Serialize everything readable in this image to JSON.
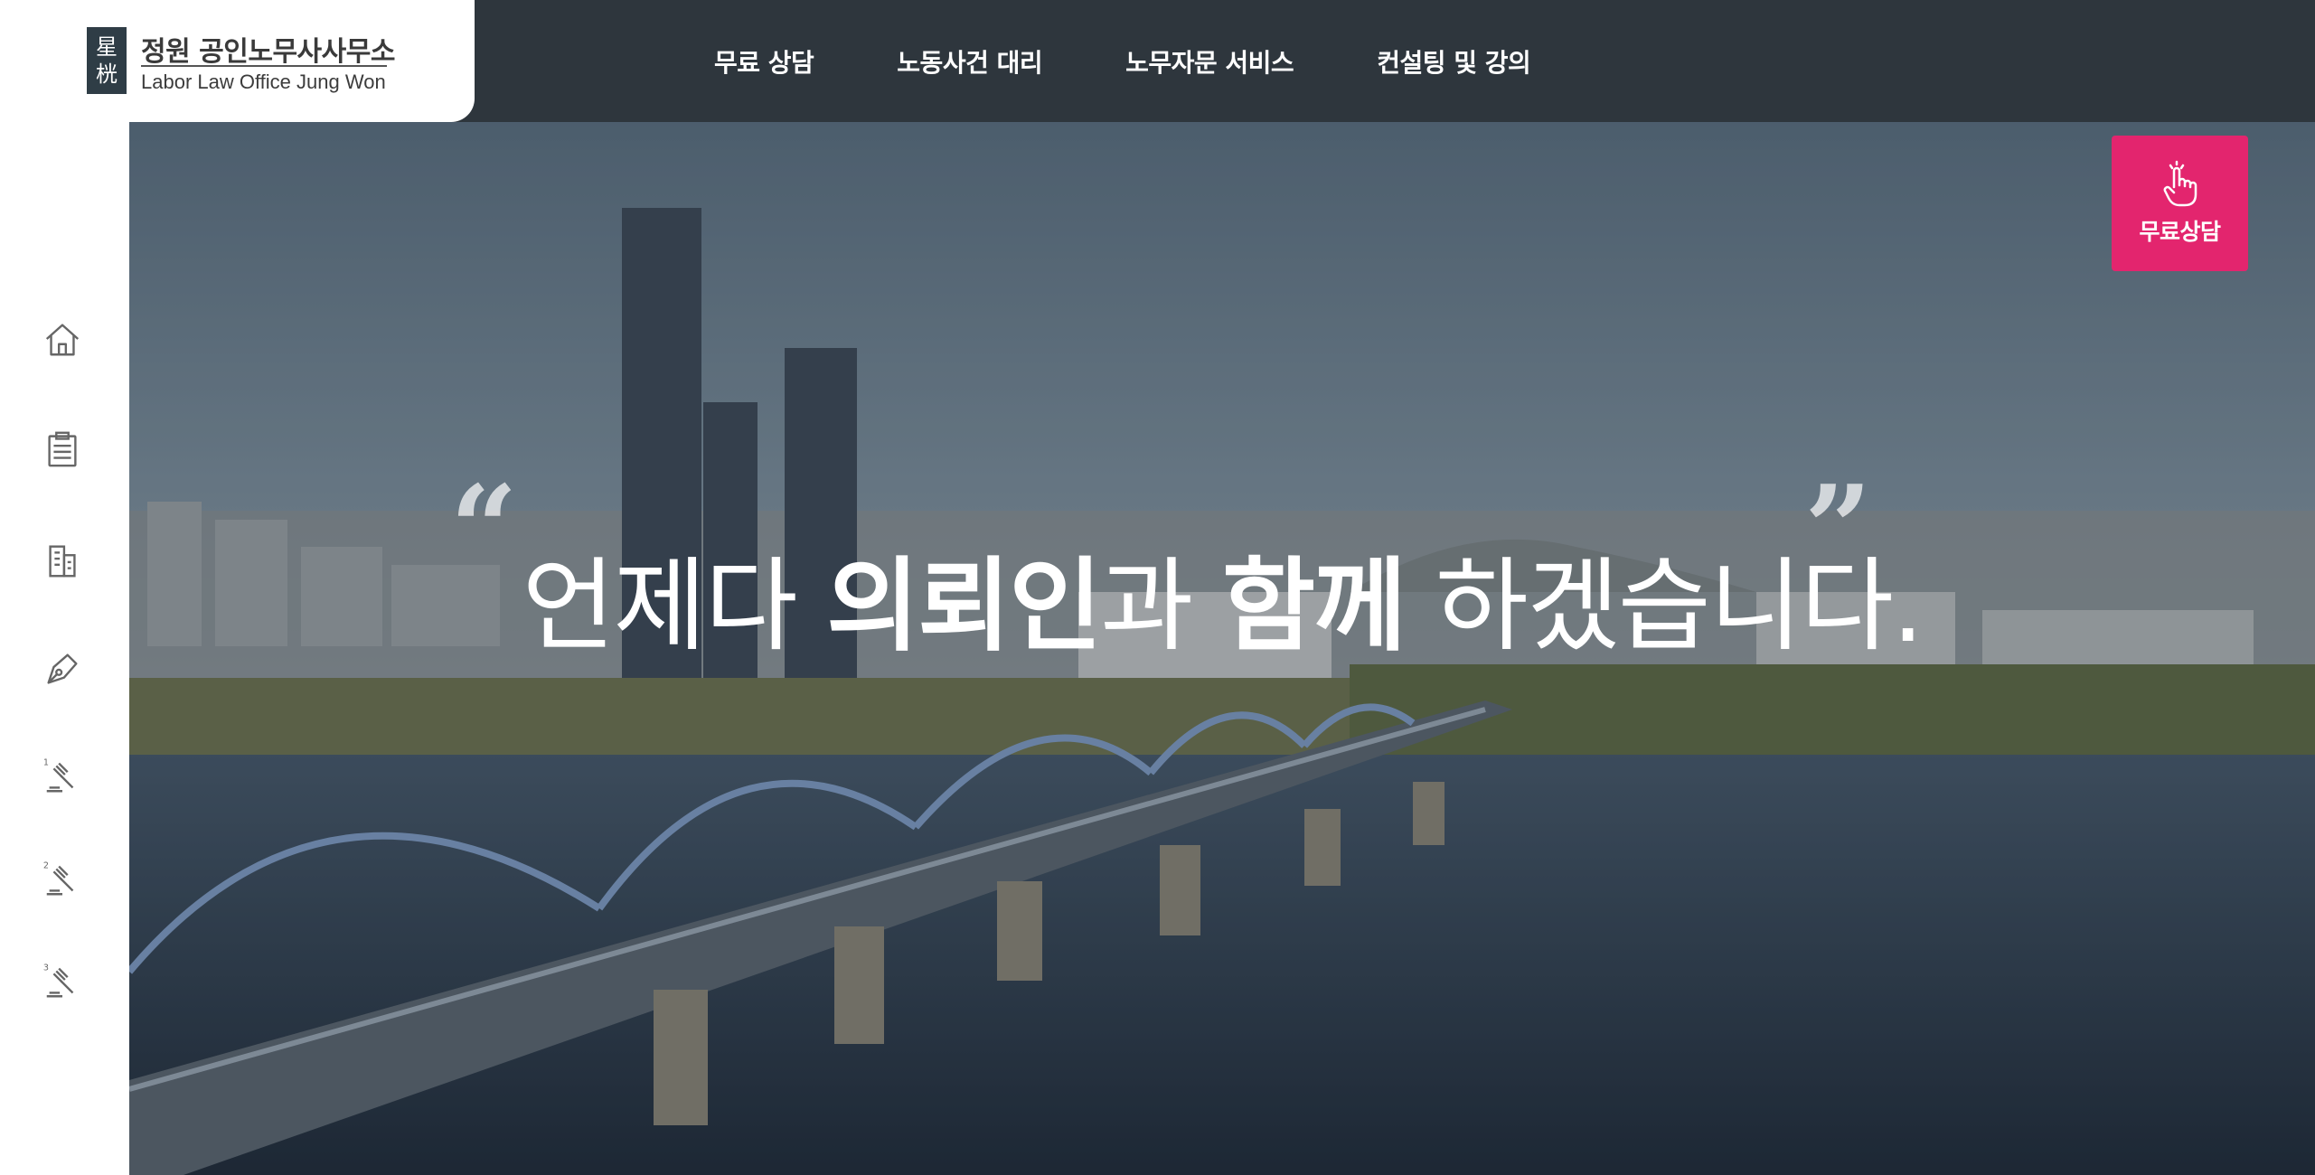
{
  "logo": {
    "seal_chars": [
      "星",
      "桄"
    ],
    "name_ko": "정원 공인노무사사무소",
    "name_en": "Labor Law Office Jung Won"
  },
  "nav": {
    "items": [
      {
        "label": "무료 상담"
      },
      {
        "label": "노동사건 대리"
      },
      {
        "label": "노무자문 서비스"
      },
      {
        "label": "컨설팅 및 강의"
      }
    ]
  },
  "sidebar": {
    "icons": [
      {
        "icon": "home-icon"
      },
      {
        "icon": "clipboard-icon"
      },
      {
        "icon": "building-icon"
      },
      {
        "icon": "pen-nib-icon"
      },
      {
        "icon": "gavel-1-icon",
        "number": "1"
      },
      {
        "icon": "gavel-2-icon",
        "number": "2"
      },
      {
        "icon": "gavel-3-icon",
        "number": "3"
      }
    ]
  },
  "hero": {
    "headline": {
      "part1": "언제다 ",
      "part2": "의뢰인",
      "part3": "과 ",
      "part4": "함께",
      "part5": " 하겠습니다."
    },
    "quote_open": "“",
    "quote_close": "”"
  },
  "cta": {
    "label": "무료상담",
    "icon": "hand-pointer-icon",
    "color": "#e3256e"
  },
  "colors": {
    "topbar": "#2e363d",
    "accent": "#e3256e"
  }
}
